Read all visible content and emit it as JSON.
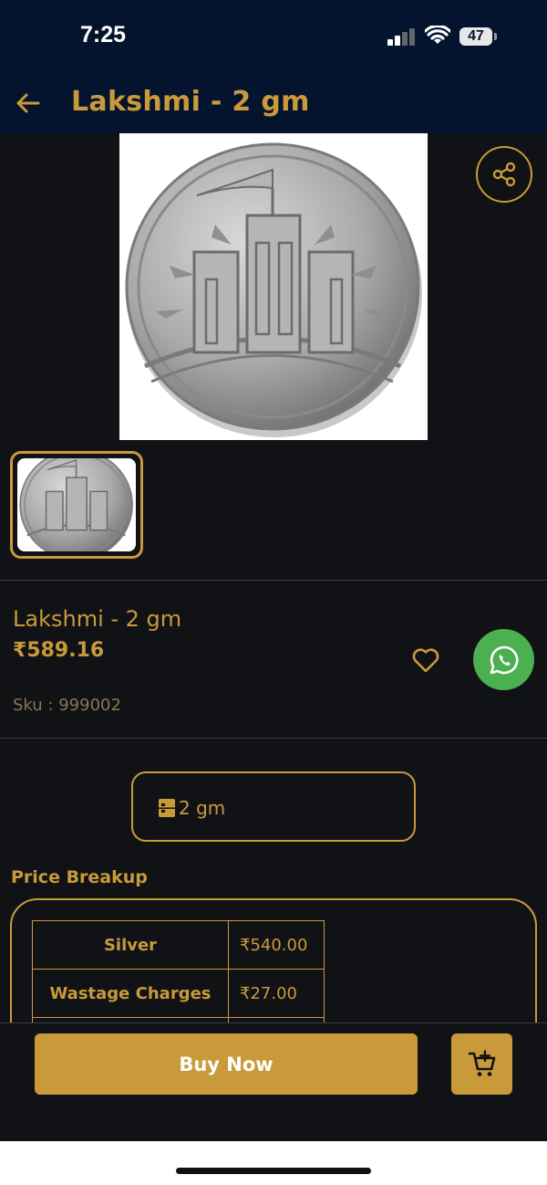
{
  "status": {
    "time": "7:25",
    "battery": "47"
  },
  "header": {
    "title": "Lakshmi - 2 gm"
  },
  "product": {
    "name": "Lakshmi - 2 gm",
    "price": "₹589.16",
    "sku": "Sku : 999002",
    "variant": "2 gm"
  },
  "price_breakup": {
    "title": "Price Breakup",
    "rows": [
      {
        "label": "Silver",
        "value": "₹540.00"
      },
      {
        "label": "Wastage Charges",
        "value": "₹27.00"
      }
    ]
  },
  "actions": {
    "buy_now": "Buy Now"
  },
  "icons": {
    "back": "arrow-left-icon",
    "share": "share-icon",
    "wishlist": "heart-icon",
    "whatsapp": "whatsapp-icon",
    "variant": "weight-icon",
    "cart": "add-to-cart-icon"
  },
  "colors": {
    "accent": "#c99a3a",
    "header_bg": "#04142e",
    "bg": "#111216",
    "whatsapp": "#4caf50"
  }
}
